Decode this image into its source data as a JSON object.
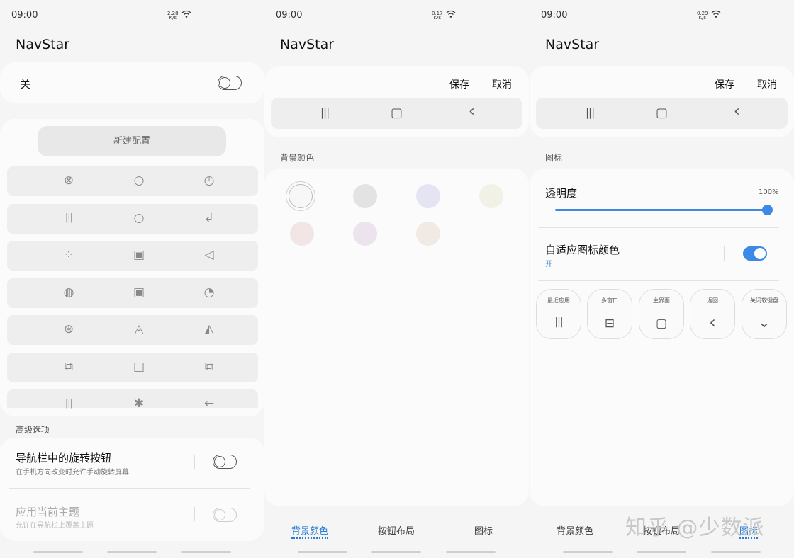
{
  "status": [
    {
      "time": "09:00",
      "speed": "2.28",
      "unit": "K/s"
    },
    {
      "time": "09:00",
      "speed": "0.17",
      "unit": "K/s"
    },
    {
      "time": "09:00",
      "speed": "0.29",
      "unit": "K/s"
    }
  ],
  "app_title": "NavStar",
  "panel1": {
    "master_toggle_label": "关",
    "new_config_label": "新建配置",
    "advanced_section": "高级选项",
    "rotate_title": "导航栏中的旋转按钮",
    "rotate_desc": "在手机方向改变时允许手动旋转屏幕",
    "theme_title": "应用当前主题",
    "theme_desc": "允许在导航栏上覆盖主题",
    "icon_rows": [
      [
        "⊗",
        "○",
        "◷"
      ],
      [
        "|||",
        "○",
        "↲"
      ],
      [
        "⁘",
        "▣",
        "◁"
      ],
      [
        "◍",
        "▣",
        "◔"
      ],
      [
        "⊛",
        "◬",
        "◭"
      ],
      [
        "⧉",
        "□",
        "⧉"
      ],
      [
        "|||",
        "✱",
        "←"
      ]
    ]
  },
  "panel2": {
    "save_label": "保存",
    "cancel_label": "取消",
    "bg_color_section": "背景颜色",
    "swatch_colors": [
      "#f7f7f7",
      "#e3e3e3",
      "#e4e4f3",
      "#f1f1e6",
      "#f1e5e6",
      "#ede3ee",
      "#f1e9e4"
    ],
    "tabs": [
      "背景颜色",
      "按钮布局",
      "图标"
    ]
  },
  "panel3": {
    "save_label": "保存",
    "cancel_label": "取消",
    "icon_section": "图标",
    "opacity_label": "透明度",
    "opacity_value": "100%",
    "opacity_fraction": 1.0,
    "adaptive_title": "自适应图标颜色",
    "adaptive_state": "开",
    "pills": [
      {
        "label": "最近应用",
        "icon": "|||"
      },
      {
        "label": "多窗口",
        "icon": "⊟"
      },
      {
        "label": "主界面",
        "icon": "▢"
      },
      {
        "label": "返回",
        "icon": "‹"
      },
      {
        "label": "关闭软键盘",
        "icon": "⌄"
      }
    ],
    "tabs": [
      "背景颜色",
      "按钮布局",
      "图标"
    ]
  },
  "nav_glyphs": {
    "recent": "|||",
    "home": "▢",
    "back": "‹"
  },
  "watermark": "知乎 @少数派",
  "colors": {
    "accent": "#2a7bd3",
    "toggle_on": "#3c8ae6"
  }
}
